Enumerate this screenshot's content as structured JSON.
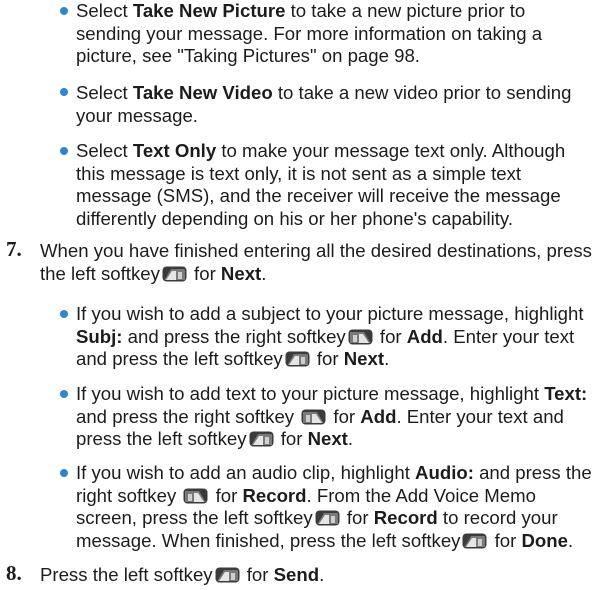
{
  "b1": {
    "pre": "Select ",
    "bold": "Take New Picture",
    "post": " to take a new picture prior to sending your message. For more information on taking a picture, see \"Taking Pictures\" on page 98."
  },
  "b2": {
    "pre": " Select ",
    "bold": "Take New Video",
    "post": " to take a new video prior to sending your message."
  },
  "b3": {
    "pre": "Select ",
    "bold": "Text Only",
    "post": " to make your message text only. Although this message is text only, it is not sent as a simple text message (SMS), and the receiver will receive the message differently depending on his or her phone's capability."
  },
  "s7": {
    "num": "7.",
    "pre": " When you have finished entering all the desired destinations, press the left softkey",
    "mid": " for ",
    "bold": "Next",
    "end": "."
  },
  "b4": {
    "pre": "If you wish to add a subject to your picture message, highlight ",
    "bold1": "Subj:",
    "mid1": " and press the right softkey",
    "mid2": " for ",
    "bold2": "Add",
    "mid3": ". Enter your text and press the left softkey",
    "mid4": " for ",
    "bold3": "Next",
    "end": "."
  },
  "b5": {
    "pre": "If you wish to add text to your picture message, highlight ",
    "bold1": "Text:",
    "mid1": " and press the right softkey ",
    "mid2": " for ",
    "bold2": "Add",
    "mid3": ". Enter your text and press the left softkey",
    "mid4": " for ",
    "bold3": "Next",
    "end": "."
  },
  "b6": {
    "pre": "If you wish to add an audio clip, highlight ",
    "bold1": "Audio:",
    "mid1": " and press the right softkey ",
    "mid2": " for ",
    "bold2": "Record",
    "mid3": ". From the Add Voice Memo screen, press the left softkey",
    "mid4": " for ",
    "bold3": "Record",
    "mid5": " to record your message. When finished, press the left softkey",
    "mid6": " for ",
    "bold4": "Done",
    "end": "."
  },
  "s8": {
    "num": "8.",
    "pre": " Press the left softkey",
    "mid": " for ",
    "bold": "Send",
    "end": "."
  },
  "icons": {
    "left_softkey": "left-softkey-icon",
    "right_softkey": "right-softkey-icon"
  }
}
